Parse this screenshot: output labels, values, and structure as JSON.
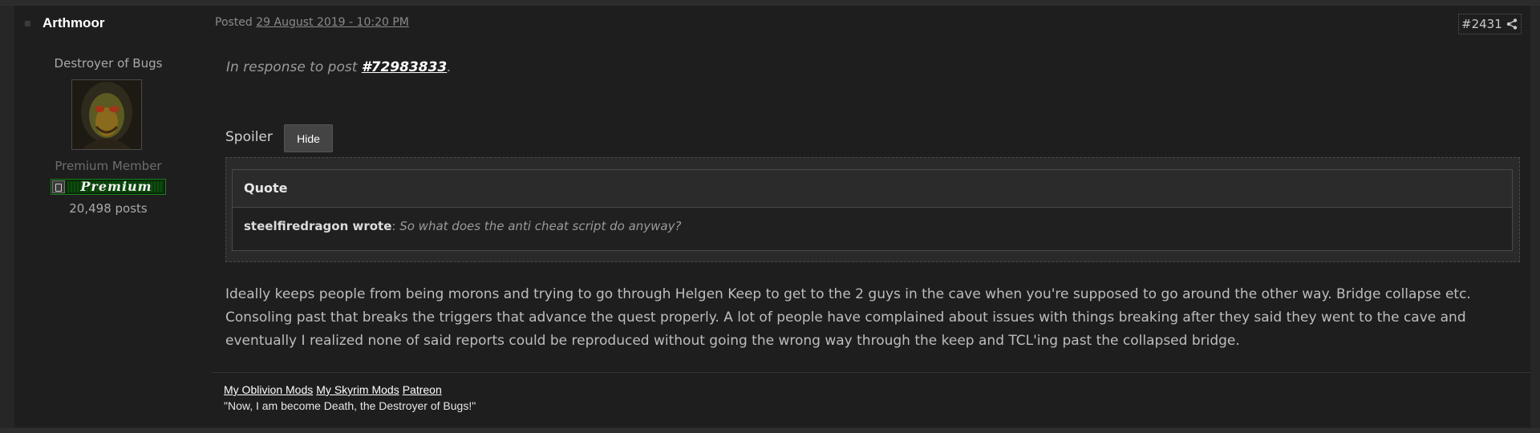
{
  "author": {
    "name": "Arthmoor",
    "title": "Destroyer of Bugs",
    "group": "Premium Member",
    "badge_text": "Premium",
    "post_count": "20,498 posts"
  },
  "header": {
    "posted_prefix": "Posted ",
    "posted_date": "29 August 2019 - 10:20 PM",
    "post_number": "#2431"
  },
  "body": {
    "response_prefix": "In response to post ",
    "response_link": "#72983833",
    "response_suffix": ".",
    "spoiler_label": "Spoiler",
    "hide_label": "Hide",
    "quote_title": "Quote",
    "quote_author": "steelfiredragon wrote",
    "quote_sep": ": ",
    "quote_text": "So what does the anti cheat script do anyway?",
    "text": "Ideally keeps people from being morons and trying to go through Helgen Keep to get to the 2 guys in the cave when you're supposed to go around the other way. Bridge collapse etc. Consoling past that breaks the triggers that advance the quest properly. A lot of people have complained about issues with things breaking after they said they went to the cave and eventually I realized none of said reports could be reproduced without going the wrong way through the keep and TCL'ing past the collapsed bridge."
  },
  "signature": {
    "links": [
      "My Oblivion Mods",
      "My Skyrim Mods",
      "Patreon"
    ],
    "quote": "\"Now, I am become Death, the Destroyer of Bugs!\""
  },
  "icons": {
    "share": "share-icon",
    "online": "online-status-icon",
    "badge": "premium-badge-icon"
  }
}
